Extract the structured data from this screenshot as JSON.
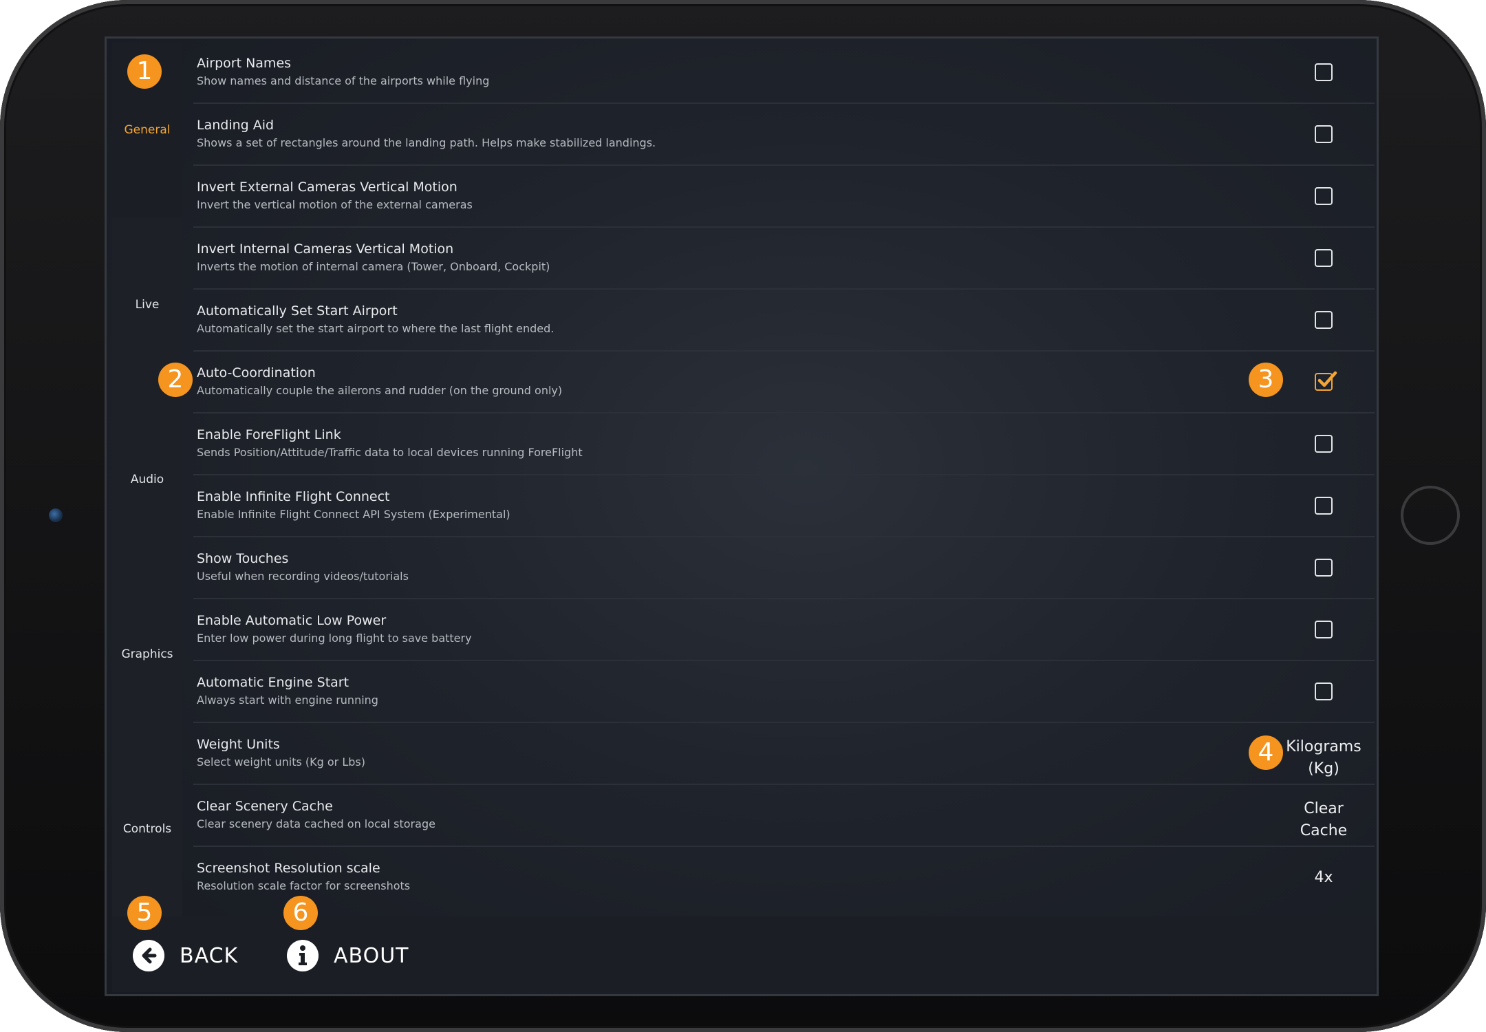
{
  "sidebar": {
    "categories": [
      {
        "label": "General",
        "active": true
      },
      {
        "label": "Live",
        "active": false
      },
      {
        "label": "Audio",
        "active": false
      },
      {
        "label": "Graphics",
        "active": false
      },
      {
        "label": "Controls",
        "active": false
      }
    ]
  },
  "settings": [
    {
      "title": "Airport Names",
      "description": "Show names and distance of the airports while flying",
      "control": "checkbox",
      "checked": false
    },
    {
      "title": "Landing Aid",
      "description": "Shows a set of rectangles around the landing path. Helps make stabilized landings.",
      "control": "checkbox",
      "checked": false
    },
    {
      "title": "Invert External Cameras Vertical Motion",
      "description": "Invert the vertical motion of the external cameras",
      "control": "checkbox",
      "checked": false
    },
    {
      "title": "Invert Internal Cameras Vertical Motion",
      "description": "Inverts the motion of internal camera (Tower, Onboard, Cockpit)",
      "control": "checkbox",
      "checked": false
    },
    {
      "title": "Automatically Set Start Airport",
      "description": "Automatically set the start airport to where the last flight ended.",
      "control": "checkbox",
      "checked": false
    },
    {
      "title": "Auto-Coordination",
      "description": "Automatically couple the ailerons and rudder (on the ground only)",
      "control": "checkbox",
      "checked": true
    },
    {
      "title": "Enable ForeFlight Link",
      "description": "Sends Position/Attitude/Traffic data to local devices running ForeFlight",
      "control": "checkbox",
      "checked": false
    },
    {
      "title": "Enable Infinite Flight Connect",
      "description": "Enable Infinite Flight Connect API System (Experimental)",
      "control": "checkbox",
      "checked": false
    },
    {
      "title": "Show Touches",
      "description": "Useful when recording videos/tutorials",
      "control": "checkbox",
      "checked": false
    },
    {
      "title": "Enable Automatic Low Power",
      "description": "Enter low power during long flight to save battery",
      "control": "checkbox",
      "checked": false
    },
    {
      "title": "Automatic Engine Start",
      "description": "Always start with engine running",
      "control": "checkbox",
      "checked": false
    },
    {
      "title": "Weight Units",
      "description": "Select weight units (Kg or Lbs)",
      "control": "value",
      "value_line1": "Kilograms",
      "value_line2": "(Kg)"
    },
    {
      "title": "Clear Scenery Cache",
      "description": "Clear scenery data cached on local storage",
      "control": "value",
      "value_line1": "Clear",
      "value_line2": "Cache"
    },
    {
      "title": "Screenshot Resolution scale",
      "description": "Resolution scale factor for screenshots",
      "control": "value",
      "value_line1": "4x"
    }
  ],
  "bottom_bar": {
    "back_label": "BACK",
    "about_label": "ABOUT"
  },
  "callouts": [
    "1",
    "2",
    "3",
    "4",
    "5",
    "6"
  ],
  "colors": {
    "accent": "#f4a534",
    "badge": "#f5941f",
    "background": "#1f232b",
    "text": "#e8eaed"
  },
  "icons": {
    "back": "arrow-left-circle-icon",
    "about": "info-circle-icon",
    "checkbox_checked": "check-icon"
  }
}
